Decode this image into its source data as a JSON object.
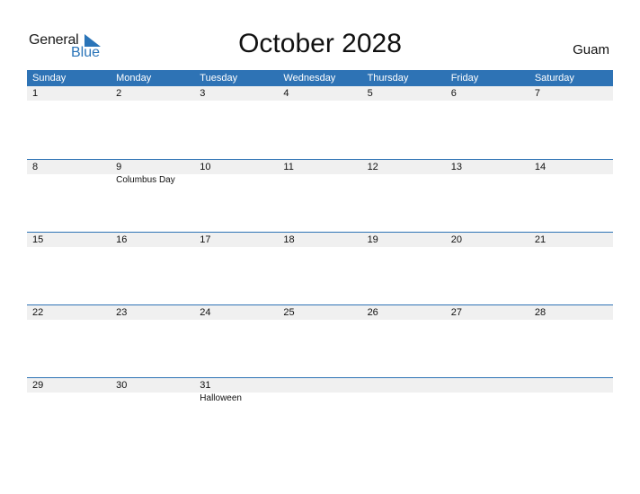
{
  "brand": {
    "line1": "General",
    "line2": "Blue",
    "accent": "#2e73b5"
  },
  "title": "October 2028",
  "country": "Guam",
  "weekdays": [
    "Sunday",
    "Monday",
    "Tuesday",
    "Wednesday",
    "Thursday",
    "Friday",
    "Saturday"
  ],
  "weeks": [
    [
      {
        "day": "1",
        "event": ""
      },
      {
        "day": "2",
        "event": ""
      },
      {
        "day": "3",
        "event": ""
      },
      {
        "day": "4",
        "event": ""
      },
      {
        "day": "5",
        "event": ""
      },
      {
        "day": "6",
        "event": ""
      },
      {
        "day": "7",
        "event": ""
      }
    ],
    [
      {
        "day": "8",
        "event": ""
      },
      {
        "day": "9",
        "event": "Columbus Day"
      },
      {
        "day": "10",
        "event": ""
      },
      {
        "day": "11",
        "event": ""
      },
      {
        "day": "12",
        "event": ""
      },
      {
        "day": "13",
        "event": ""
      },
      {
        "day": "14",
        "event": ""
      }
    ],
    [
      {
        "day": "15",
        "event": ""
      },
      {
        "day": "16",
        "event": ""
      },
      {
        "day": "17",
        "event": ""
      },
      {
        "day": "18",
        "event": ""
      },
      {
        "day": "19",
        "event": ""
      },
      {
        "day": "20",
        "event": ""
      },
      {
        "day": "21",
        "event": ""
      }
    ],
    [
      {
        "day": "22",
        "event": ""
      },
      {
        "day": "23",
        "event": ""
      },
      {
        "day": "24",
        "event": ""
      },
      {
        "day": "25",
        "event": ""
      },
      {
        "day": "26",
        "event": ""
      },
      {
        "day": "27",
        "event": ""
      },
      {
        "day": "28",
        "event": ""
      }
    ],
    [
      {
        "day": "29",
        "event": ""
      },
      {
        "day": "30",
        "event": ""
      },
      {
        "day": "31",
        "event": "Halloween"
      },
      {
        "day": "",
        "event": ""
      },
      {
        "day": "",
        "event": ""
      },
      {
        "day": "",
        "event": ""
      },
      {
        "day": "",
        "event": ""
      }
    ]
  ]
}
